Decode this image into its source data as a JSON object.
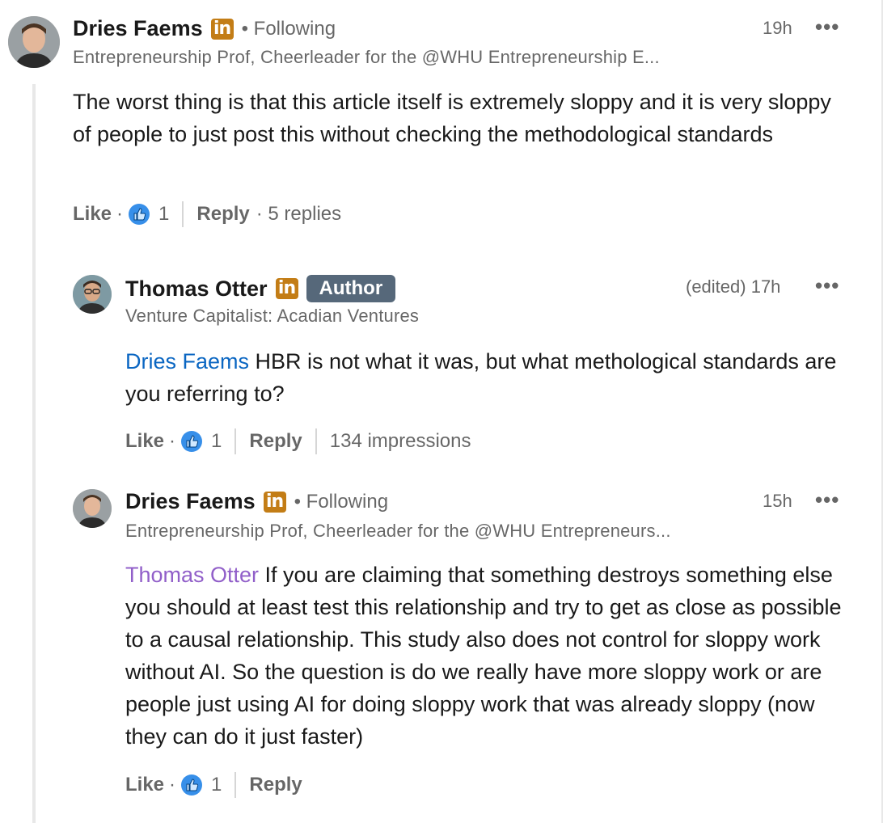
{
  "colors": {
    "mention_blue": "#0a66c2",
    "mention_purple": "#915fc9",
    "linkedin_badge": "#c37d16",
    "author_badge": "#56687a"
  },
  "comment1": {
    "name": "Dries Faems",
    "badge_icon": "linkedin-premium-icon",
    "following": "• Following",
    "headline": "Entrepreneurship Prof, Cheerleader for the @WHU Entrepreneurship E...",
    "time": "19h",
    "more": "•••",
    "text": "The worst thing is that this article itself is extremely sloppy and it is very sloppy of people to just post this without checking the methodological standards",
    "like": "Like",
    "dot": "·",
    "reaction_count": "1",
    "reply": "Reply",
    "replies": "· 5 replies"
  },
  "reply1": {
    "name": "Thomas Otter",
    "badge_icon": "linkedin-premium-icon",
    "author_badge": "Author",
    "headline": "Venture Capitalist: Acadian Ventures",
    "time": "(edited) 17h",
    "more": "•••",
    "mention": "Dries Faems",
    "text": " HBR is not what it was, but what methological standards are you referring to?",
    "like": "Like",
    "dot": "·",
    "reaction_count": "1",
    "reply": "Reply",
    "impressions": "134 impressions"
  },
  "reply2": {
    "name": "Dries Faems",
    "badge_icon": "linkedin-premium-icon",
    "following": "• Following",
    "headline": "Entrepreneurship Prof, Cheerleader for the @WHU Entrepreneurs...",
    "time": "15h",
    "more": "•••",
    "mention": "Thomas Otter",
    "text": " If you are claiming that something destroys something else you should at least test this relationship and try to get as close as possible to a causal relationship. This study also does not control for sloppy work without AI. So the question is do we really have more sloppy work or are people just using AI for doing sloppy work that was already sloppy (now they can do it just faster)",
    "like": "Like",
    "dot": "·",
    "reaction_count": "1",
    "reply": "Reply"
  }
}
